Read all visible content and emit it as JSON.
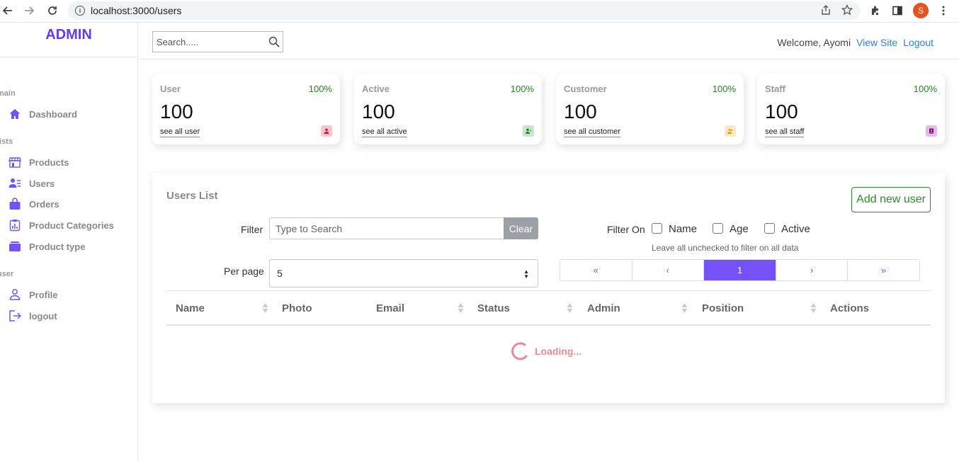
{
  "browser": {
    "url": "localhost:3000/users",
    "profile_initial": "S"
  },
  "sidebar": {
    "logo": "ADMIN",
    "sections": [
      {
        "title": "main",
        "items": [
          {
            "label": "Dashboard",
            "icon": "home-icon"
          }
        ]
      },
      {
        "title": "lists",
        "items": [
          {
            "label": "Products",
            "icon": "store-icon"
          },
          {
            "label": "Users",
            "icon": "users-list-icon"
          },
          {
            "label": "Orders",
            "icon": "bag-icon"
          },
          {
            "label": "Product Categories",
            "icon": "chart-clipboard-icon"
          },
          {
            "label": "Product type",
            "icon": "box-icon"
          }
        ]
      },
      {
        "title": "user",
        "items": [
          {
            "label": "Profile",
            "icon": "person-icon"
          },
          {
            "label": "logout",
            "icon": "logout-icon"
          }
        ]
      }
    ]
  },
  "topbar": {
    "search_placeholder": "Search.....",
    "welcome": "Welcome, Ayomi",
    "view_site": "View Site",
    "logout": "Logout"
  },
  "widgets": [
    {
      "title": "User",
      "percent": "100%",
      "value": "100",
      "link": "see all user",
      "icon_bg": "#f9c6c9",
      "icon_color": "#dc143c"
    },
    {
      "title": "Active",
      "percent": "100%",
      "value": "100",
      "link": "see all active",
      "icon_bg": "#c8e6c9",
      "icon_color": "#2e7d32"
    },
    {
      "title": "Customer",
      "percent": "100%",
      "value": "100",
      "link": "see all customer",
      "icon_bg": "#fde8c3",
      "icon_color": "#daa520"
    },
    {
      "title": "Staff",
      "percent": "100%",
      "value": "100",
      "link": "see all staff",
      "icon_bg": "#e1bee7",
      "icon_color": "#800080"
    }
  ],
  "users_list": {
    "title": "Users List",
    "add_button": "Add new user",
    "filter_label": "Filter",
    "filter_placeholder": "Type to Search",
    "clear_button": "Clear",
    "filter_on_label": "Filter On",
    "filter_options": [
      "Name",
      "Age",
      "Active"
    ],
    "filter_hint": "Leave all unchecked to filter on all data",
    "per_page_label": "Per page",
    "per_page_value": "5",
    "pagination": [
      "«",
      "‹",
      "1",
      "›",
      "»"
    ],
    "current_page": "1",
    "columns": [
      "Name",
      "Photo",
      "Email",
      "Status",
      "Admin",
      "Position",
      "Actions"
    ],
    "loading_text": "Loading..."
  },
  "colors": {
    "accent": "#7451f8",
    "logo": "#6439ff",
    "link": "#2f7ed8",
    "positive": "#1d8a1d",
    "loading": "#e88a96"
  }
}
